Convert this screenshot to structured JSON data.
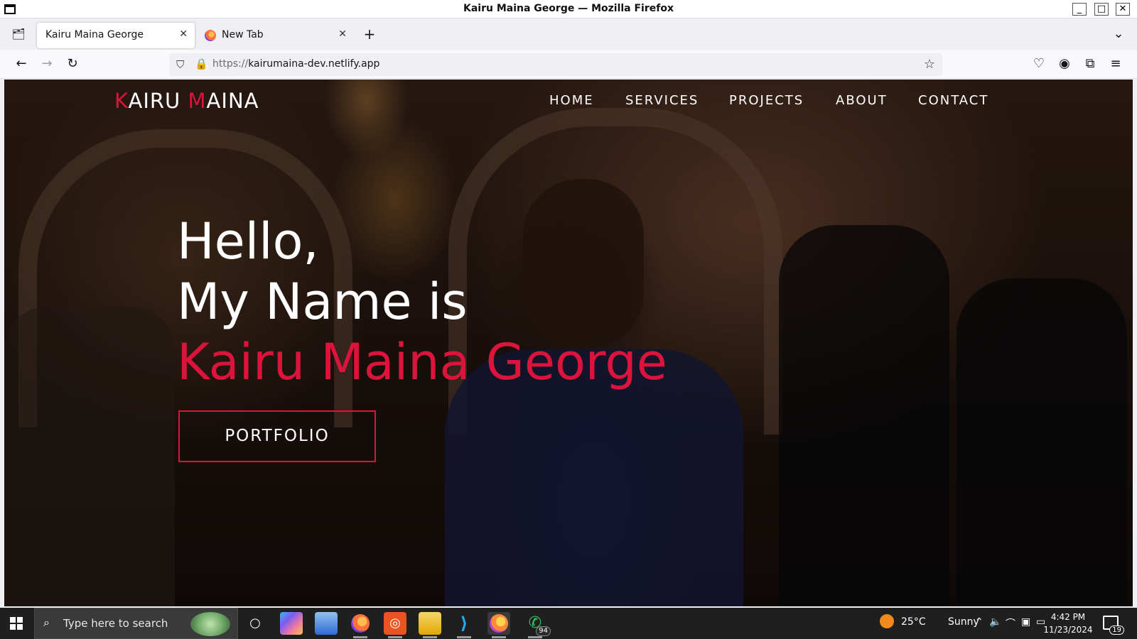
{
  "window": {
    "title": "Kairu Maina George — Mozilla Firefox",
    "minimize": "_",
    "maximize": "□",
    "close": "✕"
  },
  "tabs": [
    {
      "label": "Kairu Maina George",
      "active": true
    },
    {
      "label": "New Tab",
      "active": false
    }
  ],
  "tab_strip": {
    "new_tab": "+",
    "list_all": "⌄"
  },
  "navbar": {
    "back": "←",
    "forward": "→",
    "reload": "↻",
    "url_protocol": "https://",
    "url_host": "kairumaina-dev.netlify.app",
    "bookmark": "☆",
    "pocket": "♡",
    "account": "◉",
    "extensions": "⧉",
    "menu": "≡"
  },
  "site": {
    "logo": {
      "first_initial": "K",
      "first_rest": "AIRU ",
      "second_initial": "M",
      "second_rest": "AINA"
    },
    "nav": [
      "HOME",
      "SERVICES",
      "PROJECTS",
      "ABOUT",
      "CONTACT"
    ],
    "hero": {
      "line1": "Hello,",
      "line2": "My Name is",
      "name": "Kairu Maina George",
      "button": "PORTFOLIO"
    },
    "accent_color": "#dc143c"
  },
  "taskbar": {
    "search_placeholder": "Type here to search",
    "whatsapp_badge": "94",
    "weather": {
      "temp": "25°C",
      "condition": "Sunny"
    },
    "time": "4:42 PM",
    "date": "11/23/2024",
    "notifications": "19"
  }
}
